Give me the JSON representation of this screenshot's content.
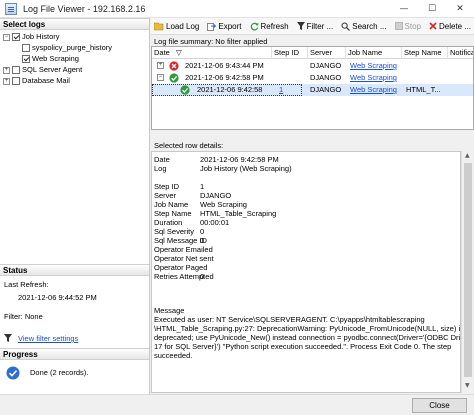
{
  "window": {
    "title": "Log File Viewer - 192.168.2.16",
    "minimize": "—",
    "maximize": "☐",
    "close": "✕"
  },
  "left_panel": {
    "select_logs_header": "Select logs",
    "tree": {
      "job_history": "Job History",
      "syspolicy": "syspolicy_purge_history",
      "web_scraping": "Web Scraping",
      "sql_server_agent": "SQL Server Agent",
      "database_mail": "Database Mail"
    },
    "status_header": "Status",
    "last_refresh_label": "Last Refresh:",
    "last_refresh_value": "2021-12-06 9:44:52 PM",
    "filter_label": "Filter: None",
    "view_filter_settings": "View filter settings",
    "progress_header": "Progress",
    "progress_text": "Done (2 records)."
  },
  "toolbar": {
    "load_log": "Load Log",
    "export": "Export",
    "refresh": "Refresh",
    "filter": "Filter ...",
    "search": "Search ...",
    "stop": "Stop",
    "delete": "Delete ..."
  },
  "summary": "Log file summary: No filter applied",
  "grid": {
    "columns": [
      "Date",
      "Step ID",
      "Server",
      "Job Name",
      "Step Name",
      "Notifica"
    ],
    "sort_indicator": "▽",
    "rows": [
      {
        "expander": "+",
        "status": "failed",
        "date": "2021-12-06 9:43:44 PM",
        "step_id": "",
        "server": "DJANGO",
        "job_name": "Web Scraping",
        "step_name": ""
      },
      {
        "expander": "−",
        "status": "success",
        "date": "2021-12-06 9:42:58 PM",
        "step_id": "",
        "server": "DJANGO",
        "job_name": "Web Scraping",
        "step_name": ""
      },
      {
        "expander": "",
        "status": "success",
        "date": "2021-12-06 9:42:58",
        "step_id": "1",
        "server": "DJANGO",
        "job_name": "Web Scraping",
        "step_name": "HTML_T..."
      }
    ]
  },
  "details": {
    "header": "Selected row details:",
    "fields": [
      {
        "label": "Date",
        "value": "2021-12-06 9:42:58 PM"
      },
      {
        "label": "Log",
        "value": "Job History (Web Scraping)"
      },
      {
        "label": "",
        "value": ""
      },
      {
        "label": "Step ID",
        "value": "1"
      },
      {
        "label": "Server",
        "value": "DJANGO"
      },
      {
        "label": "Job Name",
        "value": "Web Scraping"
      },
      {
        "label": "Step Name",
        "value": "HTML_Table_Scraping"
      },
      {
        "label": "Duration",
        "value": "00:00:01"
      },
      {
        "label": "Sql Severity",
        "value": "0"
      },
      {
        "label": "Sql Message ID",
        "value": "0"
      },
      {
        "label": "Operator Emailed",
        "value": ""
      },
      {
        "label": "Operator Net sent",
        "value": ""
      },
      {
        "label": "Operator Paged",
        "value": ""
      },
      {
        "label": "Retries Attempted",
        "value": "0"
      }
    ],
    "message_label": "Message",
    "message_lines": [
      "Executed as user: NT Service\\SQLSERVERAGENT. C:\\pyapps\\htmltablescraping",
      "\\HTML_Table_Scraping.py:27: DeprecationWarning: PyUnicode_FromUnicode(NULL, size) is",
      "deprecated; use PyUnicode_New() instead   connection = pyodbc.connect(Driver='{ODBC Driver",
      "17 for SQL Server}') \"Python script execution succeeded.\". Process Exit Code 0.  The step",
      "succeeded."
    ]
  },
  "close_button": "Close",
  "colors": {
    "accent_link": "#1a4fd6",
    "selected_row": "#d9e8fb",
    "error": "#d8252b",
    "success": "#2e9a3a"
  }
}
